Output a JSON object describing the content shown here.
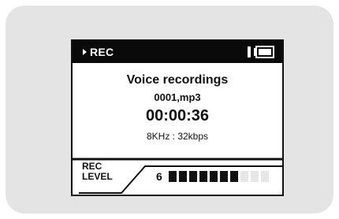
{
  "status": {
    "mode_label": "REC",
    "play_icon": "play-triangle-icon",
    "battery_icon": "battery-icon"
  },
  "recording": {
    "title": "Voice recordings",
    "filename": "0001,mp3",
    "elapsed": "00:00:36",
    "quality": "8KHz : 32kbps"
  },
  "rec_level": {
    "label_line1": "REC",
    "label_line2": "LEVEL",
    "value": "6",
    "filled_segments": 7,
    "total_segments": 10
  },
  "colors": {
    "device_bezel": "#e4e4e4",
    "screen_bg": "#ffffff",
    "ink": "#111111",
    "segment_empty": "#e6e6e6"
  }
}
